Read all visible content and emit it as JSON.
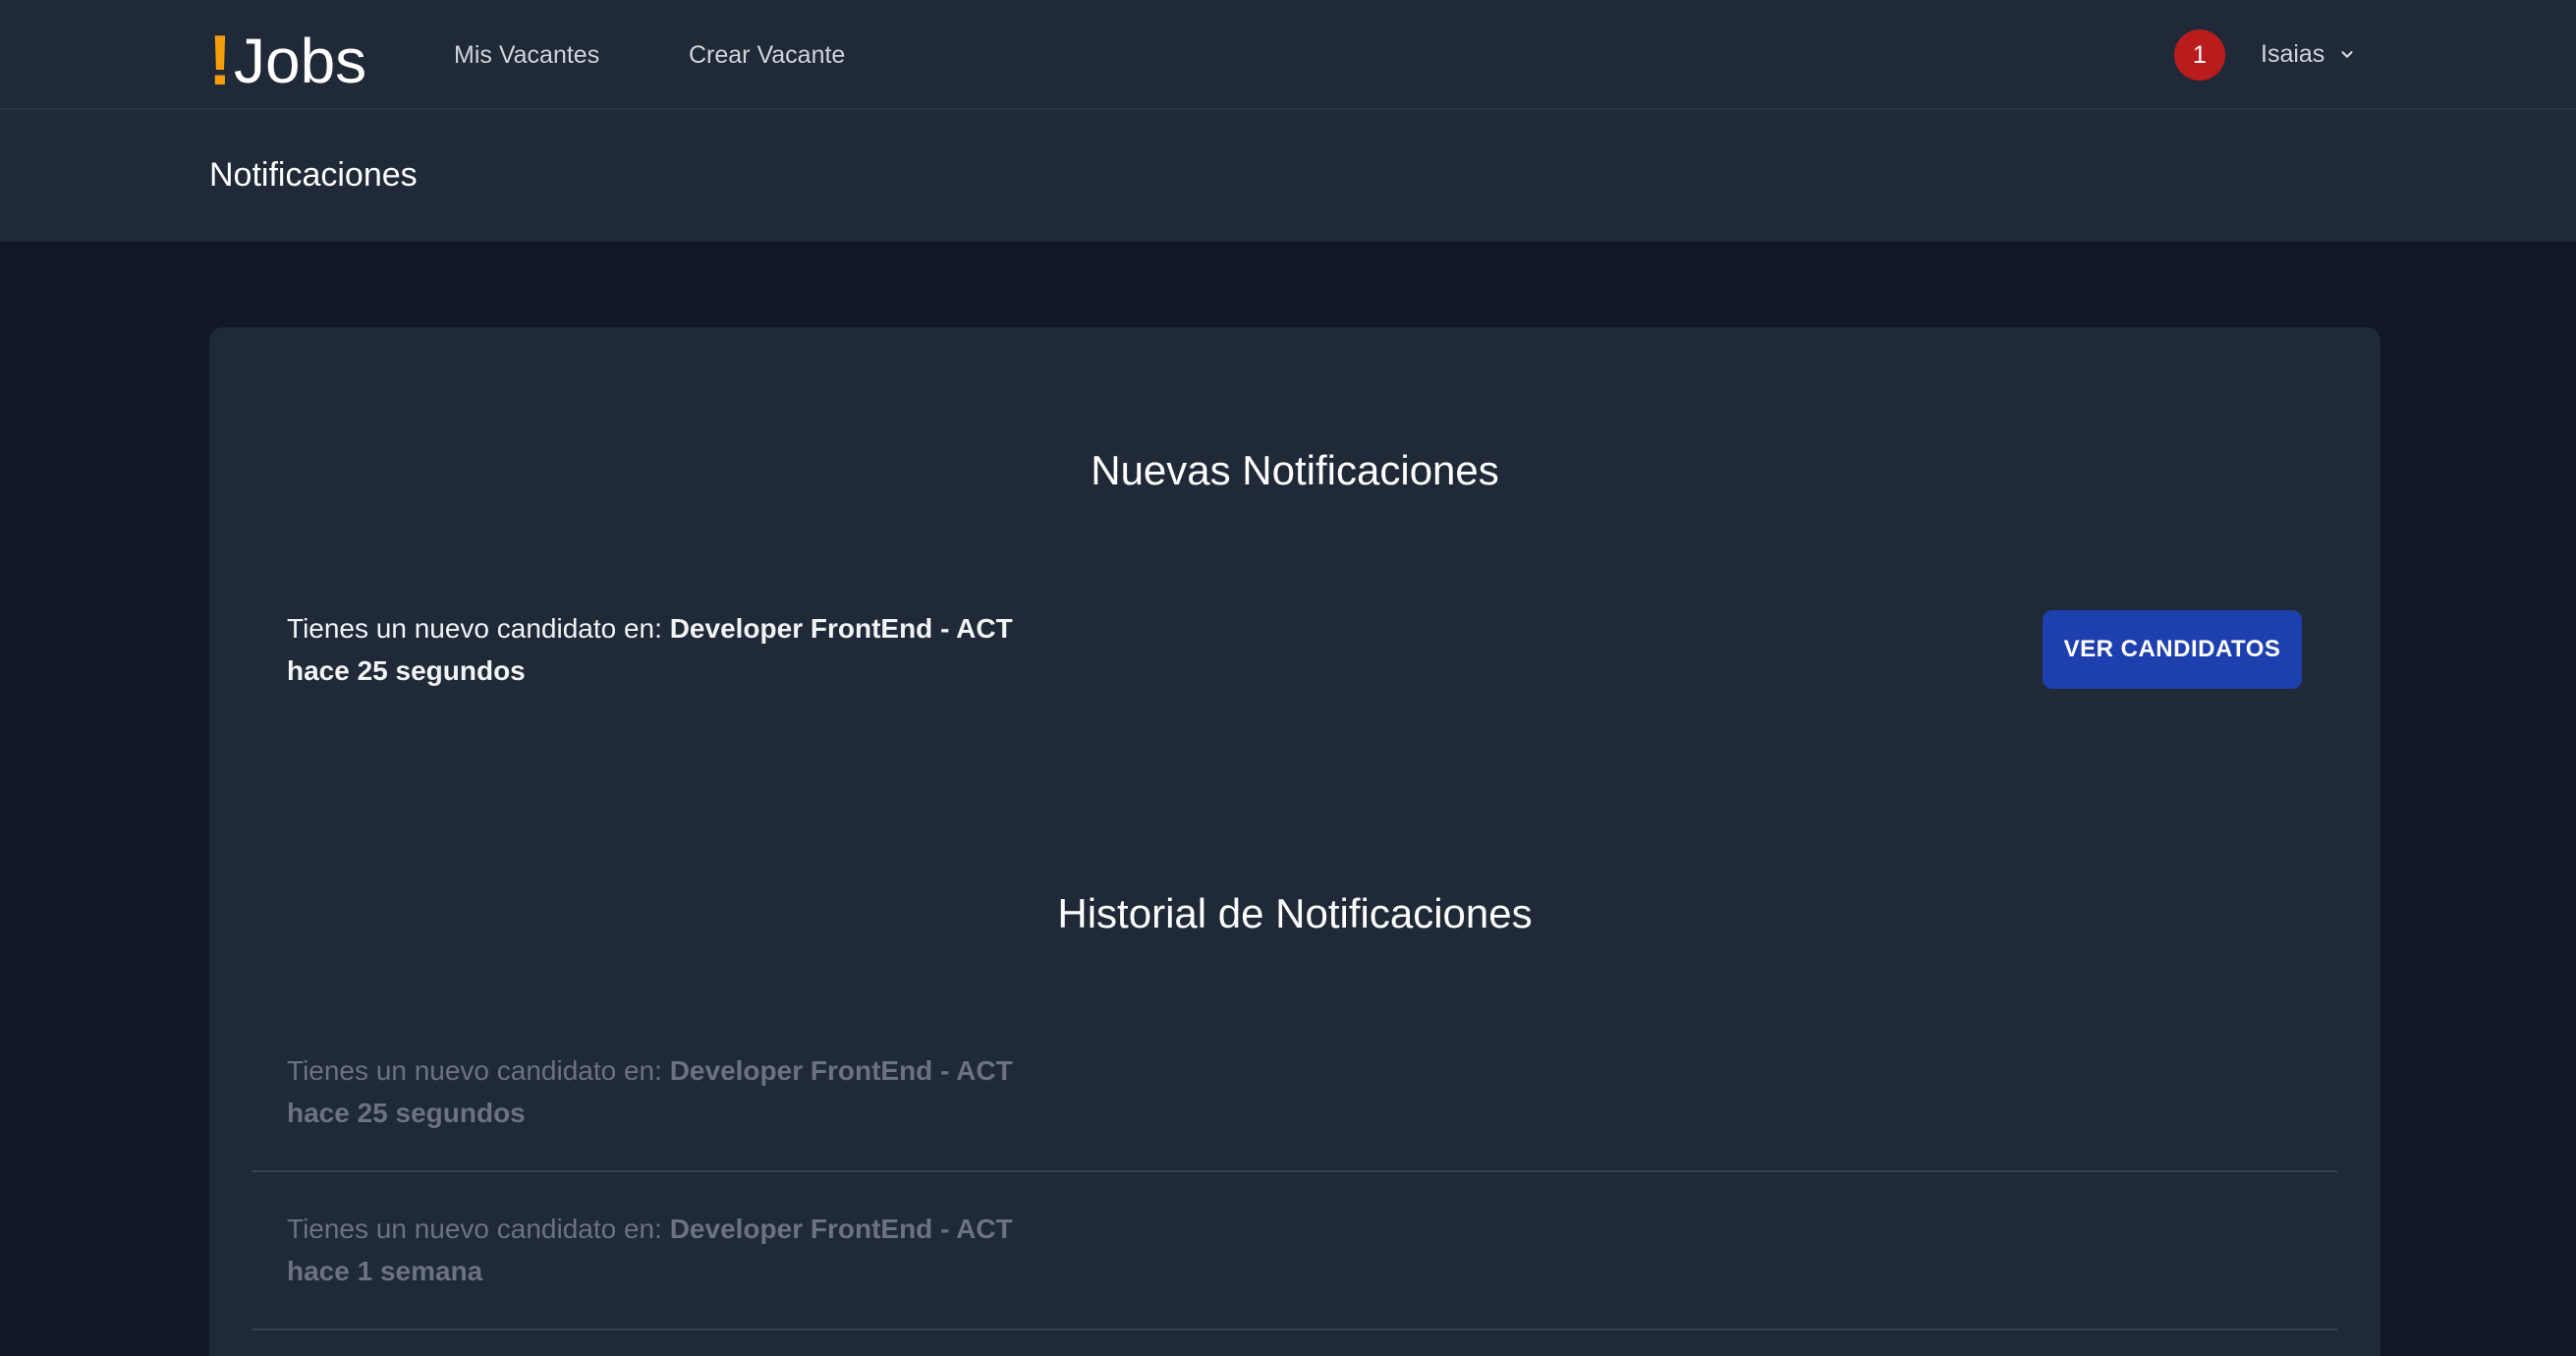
{
  "navbar": {
    "logo_mark": "!",
    "logo_text": "Jobs",
    "links": [
      "Mis Vacantes",
      "Crear Vacante"
    ],
    "notification_count": "1",
    "user_name": "Isaias"
  },
  "page": {
    "title": "Notificaciones"
  },
  "new_notifications": {
    "heading": "Nuevas Notificaciones",
    "items": [
      {
        "prefix": "Tienes un nuevo candidato en:",
        "vacancy": "Developer FrontEnd - ACT",
        "time": "hace 25 segundos",
        "button_label": "VER CANDIDATOS"
      }
    ]
  },
  "history": {
    "heading": "Historial de Notificaciones",
    "items": [
      {
        "prefix": "Tienes un nuevo candidato en:",
        "vacancy": "Developer FrontEnd - ACT",
        "time": "hace 25 segundos"
      },
      {
        "prefix": "Tienes un nuevo candidato en:",
        "vacancy": "Developer FrontEnd - ACT",
        "time": "hace 1 semana"
      }
    ]
  },
  "colors": {
    "background": "#111827",
    "surface": "#1f2937",
    "accent": "#f59e0b",
    "badge": "#b91c1c",
    "button": "#1e40af"
  }
}
